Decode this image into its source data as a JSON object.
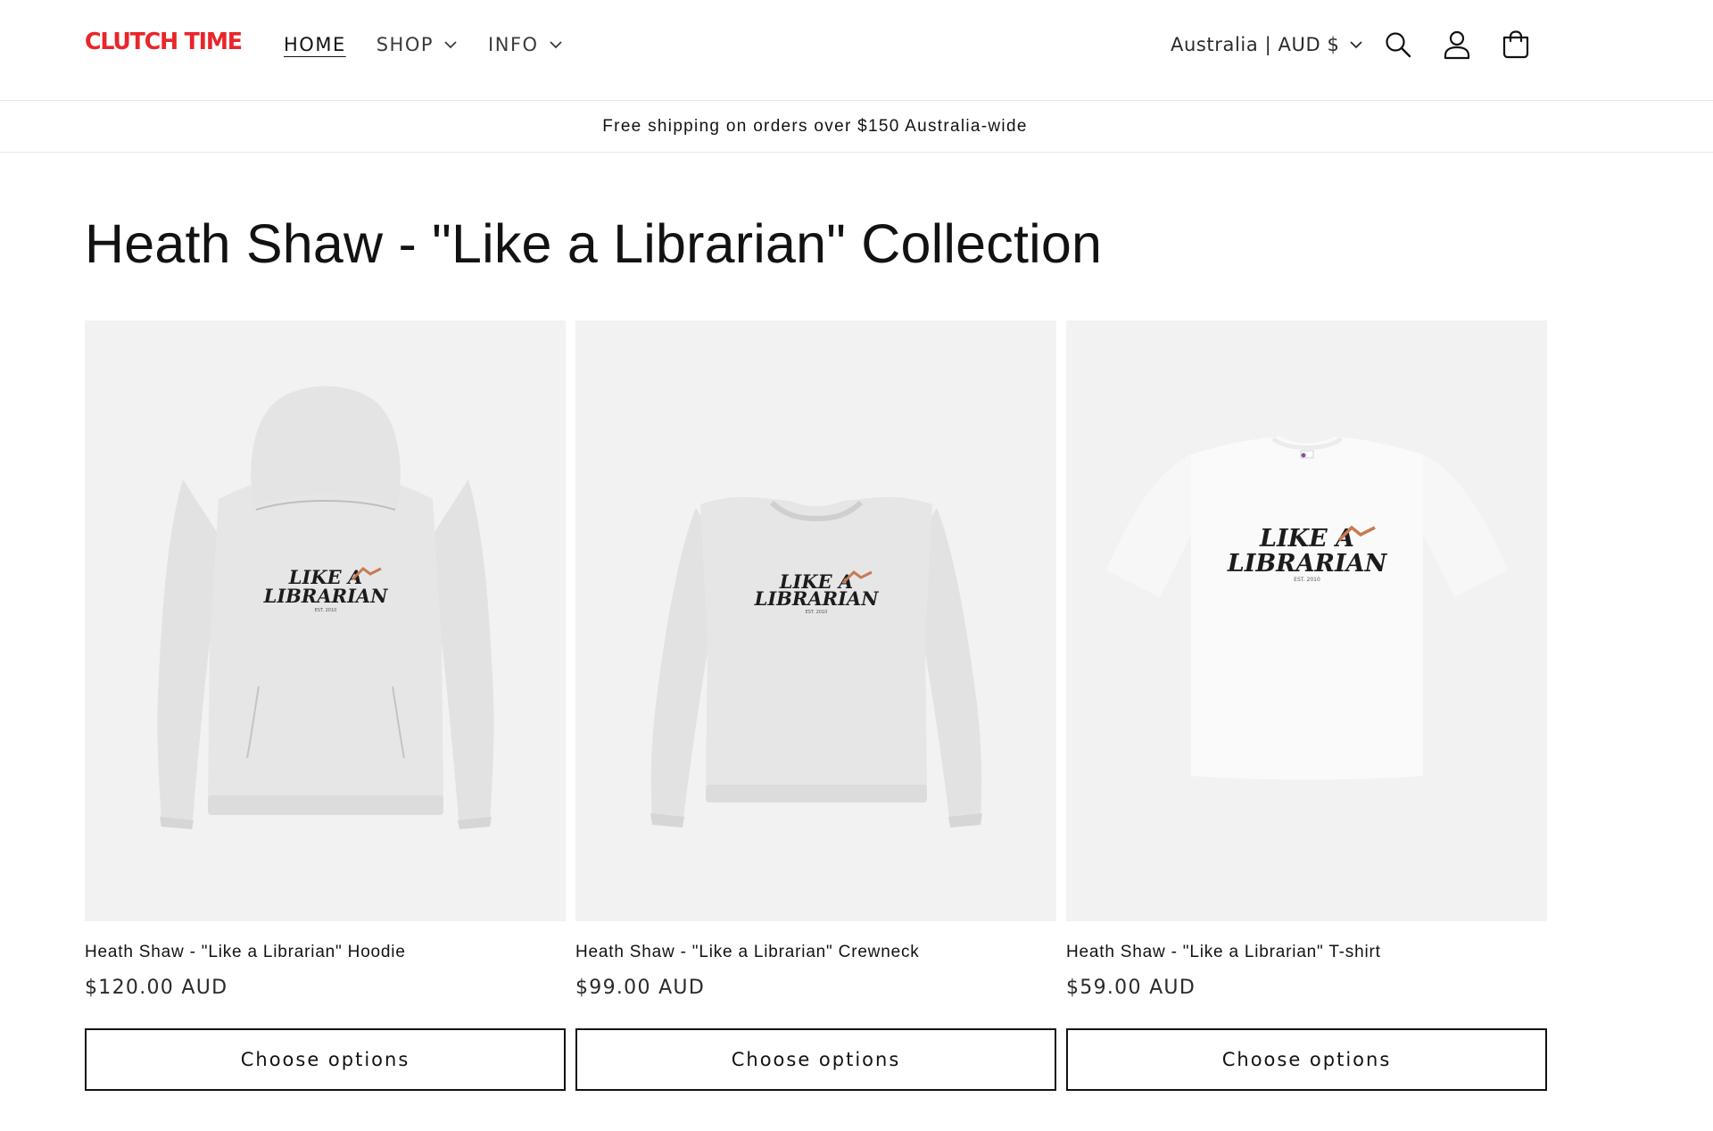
{
  "header": {
    "logo": "CLUTCH TIME",
    "nav": [
      {
        "label": "HOME",
        "active": true
      },
      {
        "label": "SHOP",
        "has_dropdown": true
      },
      {
        "label": "INFO",
        "has_dropdown": true
      }
    ],
    "country_selector": "Australia | AUD $",
    "icons": [
      "search-icon",
      "account-icon",
      "cart-icon"
    ],
    "brand_color": "#e8262b"
  },
  "announcement": "Free shipping on orders over $150 Australia-wide",
  "collection": {
    "title": "Heath Shaw - \"Like a Librarian\" Collection"
  },
  "products": [
    {
      "title": "Heath Shaw - \"Like a Librarian\" Hoodie",
      "price": "$120.00 AUD",
      "button": "Choose options",
      "image": "grey-hoodie"
    },
    {
      "title": "Heath Shaw - \"Like a Librarian\" Crewneck",
      "price": "$99.00 AUD",
      "button": "Choose options",
      "image": "grey-crewneck"
    },
    {
      "title": "Heath Shaw - \"Like a Librarian\" T-shirt",
      "price": "$59.00 AUD",
      "button": "Choose options",
      "image": "white-tshirt"
    }
  ],
  "graphic_print": {
    "line1": "LIKE A",
    "line2": "LIBRARIAN",
    "line3": "EST. 2010"
  }
}
